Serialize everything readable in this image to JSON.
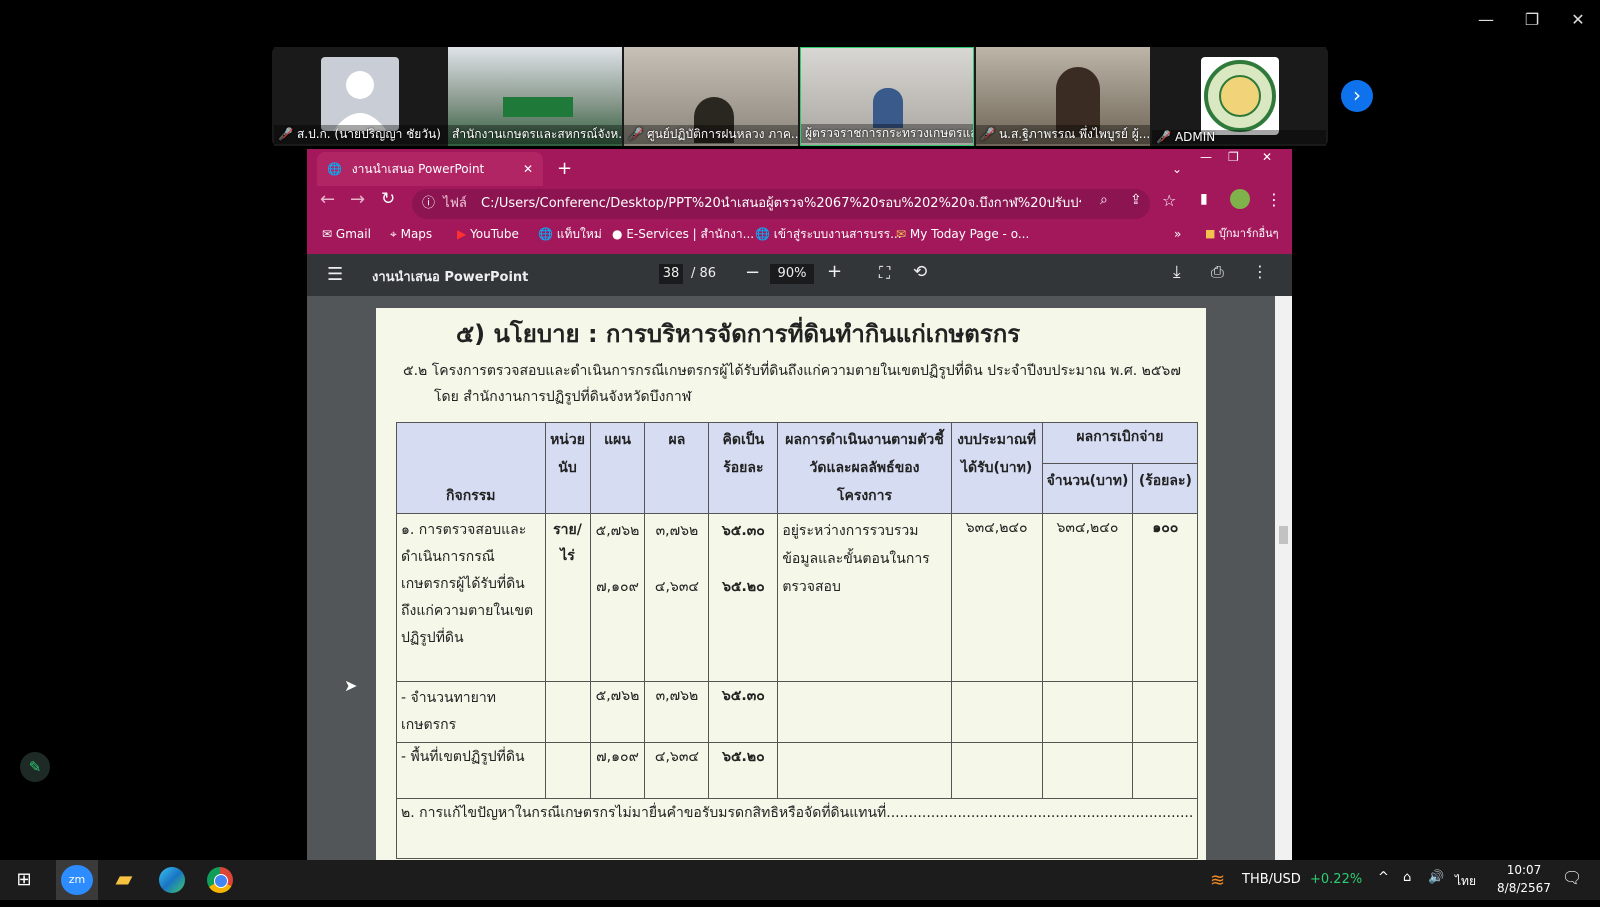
{
  "window_controls": {
    "minimize": "—",
    "restore": "❐",
    "close": "✕"
  },
  "participants": [
    {
      "name": "ส.ป.ก. (นายปริญญา ชัยวัน)",
      "muted": true
    },
    {
      "name": "สำนักงานเกษตรและสหกรณ์จังห...",
      "muted": false
    },
    {
      "name": "ศูนย์ปฏิบัติการฝนหลวง ภาค...",
      "muted": true
    },
    {
      "name": "ผู้ตรวจราชการกระทรวงเกษตรแล...",
      "muted": false
    },
    {
      "name": "น.ส.ฐิภาพรรณ พึ่งไพบูรย์ ผู้...",
      "muted": true
    },
    {
      "name": "ADMIN",
      "muted": true
    }
  ],
  "browser": {
    "tab_title": "งานนำเสนอ PowerPoint",
    "new_tab": "+",
    "address_prefix": "ไฟล์",
    "address": "C:/Users/Conferenc/Desktop/PPT%20นำเสนอผู้ตรวจ%2067%20รอบ%202%20จ.บึงกาฬ%20ปรับปรุง.pdf",
    "bookmarks": [
      "Gmail",
      "Maps",
      "YouTube",
      "แท็บใหม่",
      "E-Services | สำนักงา...",
      "เข้าสู่ระบบงานสารบรร...",
      "My Today Page - o..."
    ],
    "bookmarks_more": "»",
    "bookmarks_other": "บุ๊กมาร์กอื่นๆ"
  },
  "pdf": {
    "title": "งานนำเสนอ PowerPoint",
    "page_current": "38",
    "page_total": "/ 86",
    "zoom": "90%"
  },
  "slide": {
    "heading": "๕) นโยบาย : การบริหารจัดการที่ดินทำกินแก่เกษตรกร",
    "sub1": "๕.๒ โครงการตรวจสอบและดำเนินการกรณีเกษตรกรผู้ได้รับที่ดินถึงแก่ความตายในเขตปฏิรูปที่ดิน ประจำปีงบประมาณ พ.ศ. ๒๕๖๗",
    "sub2": "โดย สำนักงานการปฏิรูปที่ดินจังหวัดบึงกาฬ",
    "headers": {
      "activity": "กิจกรรม",
      "unit": "หน่วยนับ",
      "plan": "แผน",
      "result": "ผล",
      "percent": "คิดเป็นร้อยละ",
      "kpi": "ผลการดำเนินงานตามตัวชี้วัดและผลลัพธ์ของโครงการ",
      "budget": "งบประมาณที่ได้รับ(บาท)",
      "disburse": "ผลการเบิกจ่าย",
      "amount": "จำนวน(บาท)",
      "pct": "(ร้อยละ)"
    },
    "row1": {
      "activity": "๑. การตรวจสอบและดำเนินการกรณีเกษตรกรผู้ได้รับที่ดินถึงแก่ความตายในเขตปฏิรูปที่ดิน",
      "unit": "ราย/ไร่",
      "plan1": "๕,๗๖๒",
      "result1": "๓,๗๖๒",
      "pct1": "๖๕.๓๐",
      "plan2": "๗,๑๐๙",
      "result2": "๔,๖๓๔",
      "pct2": "๖๕.๒๐",
      "kpi": "อยู่ระหว่างการรวบรวมข้อมูลและขั้นตอนในการตรวจสอบ",
      "budget": "๖๓๔,๒๔๐",
      "amount": "๖๓๔,๒๔๐",
      "disb_pct": "๑๐๐"
    },
    "row2": {
      "activity": "- จำนวนทายาทเกษตรกร",
      "plan": "๕,๗๖๒",
      "result": "๓,๗๖๒",
      "pct": "๖๕.๓๐"
    },
    "row3": {
      "activity": "- พื้นที่เขตปฏิรูปที่ดิน",
      "plan": "๗,๑๐๙",
      "result": "๔,๖๓๔",
      "pct": "๖๕.๒๐"
    },
    "row4": {
      "activity": "๒. การแก้ไขปัญหาในกรณีเกษตรกรไม่มายื่นคำขอรับมรดกสิทธิหรือจัดที่ดินแทนที่....................................................................."
    }
  },
  "taskbar": {
    "currency": "THB/USD",
    "currency_change": "+0.22%",
    "lang": "ไทย",
    "time": "10:07",
    "date": "8/8/2567"
  },
  "colors": {
    "browser": "#a3185b",
    "accent": "#0e72ed",
    "green": "#2ecc71"
  }
}
